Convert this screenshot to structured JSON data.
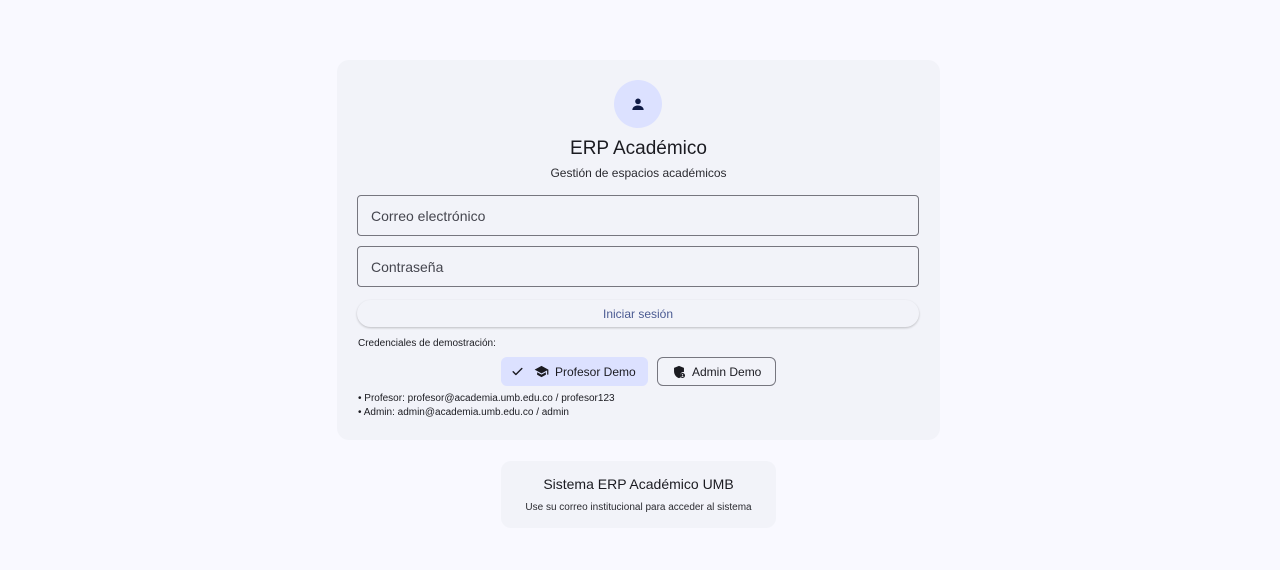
{
  "header": {
    "icon": "person-icon",
    "title": "ERP Académico",
    "subtitle": "Gestión de espacios académicos"
  },
  "form": {
    "email_placeholder": "Correo electrónico",
    "password_placeholder": "Contraseña",
    "submit_label": "Iniciar sesión"
  },
  "demo": {
    "caption": "Credenciales de demostración:",
    "chips": [
      {
        "label": "Profesor Demo",
        "icon": "graduation-cap-icon",
        "selected": true
      },
      {
        "label": "Admin Demo",
        "icon": "admin-shield-icon",
        "selected": false
      }
    ],
    "lines": [
      "• Profesor: profesor@academia.umb.edu.co / profesor123",
      "• Admin: admin@academia.umb.edu.co / admin"
    ]
  },
  "footer": {
    "title": "Sistema ERP Académico UMB",
    "subtitle": "Use su correo institucional para acceder al sistema"
  },
  "colors": {
    "background": "#f9f9ff",
    "card": "#f2f3f9",
    "primary_container": "#dce1ff",
    "primary_text": "#4a5a92",
    "outline": "#76767f"
  }
}
